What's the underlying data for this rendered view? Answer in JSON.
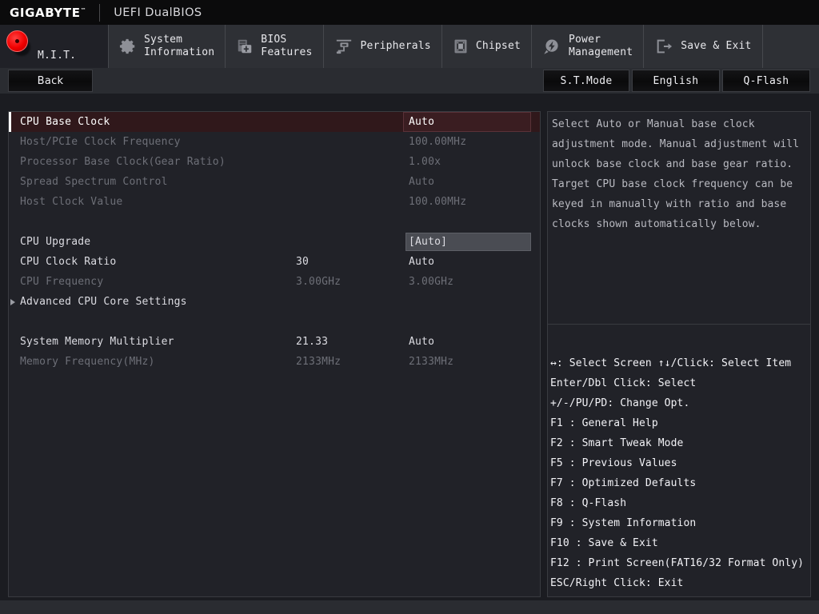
{
  "brand": {
    "logo": "GIGABYTE",
    "trademark": "™",
    "subtitle": "UEFI DualBIOS"
  },
  "nav": {
    "tabs": [
      {
        "id": "mit",
        "label": "M.I.T.",
        "icon": "red-disc-icon",
        "active": true
      },
      {
        "id": "sysinfo",
        "label": "System\nInformation",
        "icon": "gear-icon",
        "active": false
      },
      {
        "id": "bios",
        "label": "BIOS\nFeatures",
        "icon": "bios-chip-plus-icon",
        "active": false
      },
      {
        "id": "periph",
        "label": "Peripherals",
        "icon": "peripherals-icon",
        "active": false
      },
      {
        "id": "chipset",
        "label": "Chipset",
        "icon": "chipset-icon",
        "active": false
      },
      {
        "id": "power",
        "label": "Power\nManagement",
        "icon": "power-bolt-icon",
        "active": false
      },
      {
        "id": "saveexit",
        "label": "Save & Exit",
        "icon": "exit-arrow-icon",
        "active": false
      }
    ]
  },
  "toolbar": {
    "back_label": "Back",
    "stmode_label": "S.T.Mode",
    "language_label": "English",
    "qflash_label": "Q-Flash"
  },
  "settings": {
    "rows": [
      {
        "name": "CPU Base Clock",
        "mid": "",
        "value": "Auto",
        "state": "highlight",
        "arrow": false
      },
      {
        "name": "Host/PCIe Clock Frequency",
        "mid": "",
        "value": "100.00MHz",
        "state": "disabled",
        "arrow": false
      },
      {
        "name": "Processor Base Clock(Gear Ratio)",
        "mid": "",
        "value": "1.00x",
        "state": "disabled",
        "arrow": false
      },
      {
        "name": "Spread Spectrum Control",
        "mid": "",
        "value": "Auto",
        "state": "disabled",
        "arrow": false
      },
      {
        "name": "Host Clock Value",
        "mid": "",
        "value": "100.00MHz",
        "state": "disabled",
        "arrow": false
      },
      {
        "name": "",
        "mid": "",
        "value": "",
        "state": "spacer",
        "arrow": false
      },
      {
        "name": "CPU Upgrade",
        "mid": "",
        "value": "[Auto]",
        "state": "selected",
        "arrow": false
      },
      {
        "name": "CPU Clock Ratio",
        "mid": "30",
        "value": "Auto",
        "state": "enabled",
        "arrow": false
      },
      {
        "name": "CPU Frequency",
        "mid": "3.00GHz",
        "value": "3.00GHz",
        "state": "disabled",
        "arrow": false
      },
      {
        "name": "Advanced CPU Core Settings",
        "mid": "",
        "value": "",
        "state": "enabled",
        "arrow": true
      },
      {
        "name": "",
        "mid": "",
        "value": "",
        "state": "spacer",
        "arrow": false
      },
      {
        "name": "System Memory Multiplier",
        "mid": "21.33",
        "value": "Auto",
        "state": "enabled",
        "arrow": false
      },
      {
        "name": "Memory Frequency(MHz)",
        "mid": "2133MHz",
        "value": "2133MHz",
        "state": "disabled",
        "arrow": false
      }
    ]
  },
  "help": {
    "lines": [
      "Select Auto or Manual base clock",
      "adjustment mode. Manual adjustment will",
      "unlock base clock and base gear ratio.",
      "Target CPU base clock frequency can be",
      "keyed in manually with ratio and base",
      "clocks shown automatically below."
    ]
  },
  "legend": {
    "lines": [
      "↔: Select Screen   ↑↓/Click: Select Item",
      "Enter/Dbl Click: Select",
      "+/-/PU/PD: Change Opt.",
      "F1  : General Help",
      "F2  : Smart Tweak Mode",
      "F5  : Previous Values",
      "F7  : Optimized Defaults",
      "F8  : Q-Flash",
      "F9  : System Information",
      "F10 : Save & Exit",
      "F12 : Print Screen(FAT16/32 Format Only)",
      "ESC/Right Click: Exit"
    ]
  },
  "colors": {
    "background": "#17181c",
    "panel": "#212228",
    "nav_bar": "#2e3035",
    "accent_red": "#f00000",
    "highlight_row": "#30181b",
    "text_enabled": "#dcdce2",
    "text_disabled": "#6d6f77",
    "border": "#393b40"
  }
}
